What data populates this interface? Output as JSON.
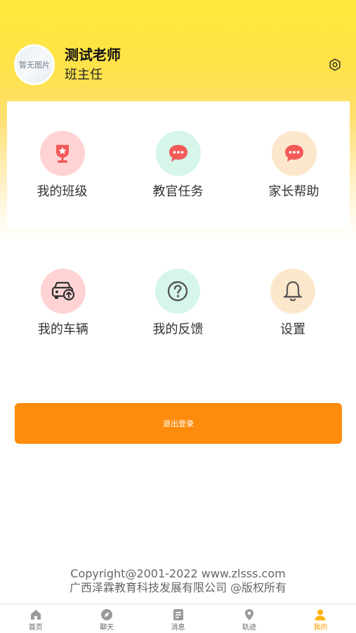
{
  "profile": {
    "avatar_placeholder": "暂无图片",
    "name": "测试老师",
    "role": "班主任"
  },
  "menu_row1": [
    {
      "label": "我的班级",
      "icon": "trophy-icon"
    },
    {
      "label": "教官任务",
      "icon": "chat-bubble-icon"
    },
    {
      "label": "家长帮助",
      "icon": "chat-bubble-icon"
    }
  ],
  "menu_row2": [
    {
      "label": "我的车辆",
      "icon": "car-icon"
    },
    {
      "label": "我的反馈",
      "icon": "question-icon"
    },
    {
      "label": "设置",
      "icon": "bell-icon"
    }
  ],
  "logout_label": "退出登录",
  "copyright": {
    "line1": "Copyright@2001-2022 www.zlsss.com",
    "line2": "广西泽霖教育科技发展有限公司 @版权所有"
  },
  "tabbar": [
    {
      "label": "首页",
      "icon": "home-icon"
    },
    {
      "label": "聊天",
      "icon": "compass-icon"
    },
    {
      "label": "消息",
      "icon": "message-icon"
    },
    {
      "label": "轨迹",
      "icon": "location-icon"
    },
    {
      "label": "我的",
      "icon": "user-icon"
    }
  ],
  "colors": {
    "accent": "#fe8c0c",
    "tab_active": "#ff9c00",
    "header_yellow": "#ffe93a"
  }
}
